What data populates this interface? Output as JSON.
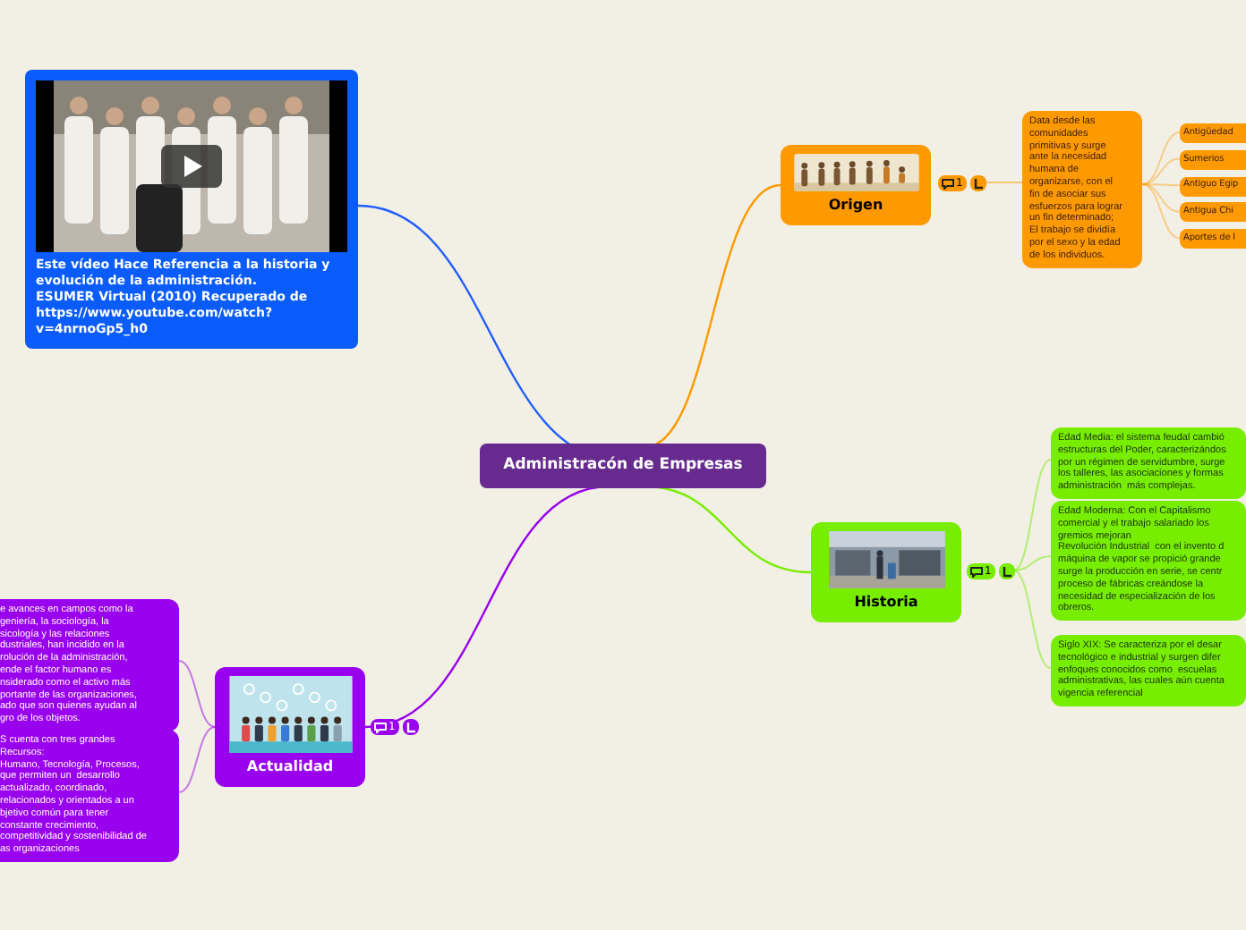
{
  "central": {
    "title": "Administracón de Empresas"
  },
  "video_card": {
    "lines": [
      "Este vídeo Hace Referencia a la historia y",
      "evolución de la administración.",
      "ESUMER Virtual (2010) Recuperado de",
      "https://www.youtube.com/watch?",
      "v=4nrnoGp5_h0"
    ]
  },
  "topics": [
    {
      "title": "Origen",
      "color": "#ff9900",
      "comment_count": "1",
      "notes": [
        {
          "lines": [
            "Data desde las",
            "comunidades",
            "primitivas y surge",
            "ante la necesidad",
            "humana de",
            "organizarse, con el",
            "fin de asociar sus",
            "esfuerzos para lograr",
            "un fin determinado;",
            "El trabajo se dividía",
            "por el sexo y la edad",
            "de los individuos."
          ]
        }
      ],
      "subtopics": [
        "Antigüedad",
        "Sumerios",
        "Antiguo Egip",
        "Antigua Chi",
        "Aportes de l"
      ]
    },
    {
      "title": "Historia",
      "color": "#77ee00",
      "comment_count": "1",
      "notes": [
        {
          "lines": [
            "Edad Media: el sistema feudal cambió",
            "estructuras del Poder, caracterizándos",
            "por un régimen de servidumbre, surge",
            "los talleres, las asociaciones y formas",
            "administración  más complejas."
          ]
        },
        {
          "lines": [
            "Edad Moderna: Con el Capitalismo",
            "comercial y el trabajo salariado los",
            "gremios mejoran",
            "Revolución Industrial  con el invento d",
            "máquina de vapor se propició grande",
            "surge la producción en serie, se centr",
            "proceso de fábricas creándose la",
            "necesidad de especialización de los",
            "obreros."
          ]
        },
        {
          "lines": [
            "Siglo XIX: Se caracteriza por el desar",
            "tecnológico e industrial y surgen difer",
            "enfoques conocidos como  escuelas",
            "administrativas, las cuales aún cuenta",
            "vigencia referencial"
          ]
        }
      ]
    },
    {
      "title": "Actualidad",
      "color": "#9900ee",
      "comment_count": "1",
      "notes": [
        {
          "lines": [
            "e avances en campos como la",
            "geniería, la sociología, la",
            "sicología y las relaciones",
            "dustriales, han incidido en la",
            "rolución de la administración,",
            "ende el factor humano es",
            "nsiderado como el activo más",
            "portante de las organizaciones,",
            "ado que son quienes ayudan al",
            "gro de los objetos."
          ]
        },
        {
          "lines": [
            "S cuenta con tres grandes",
            "Recursos:",
            "Humano, Tecnología, Procesos,",
            "que permiten un  desarrollo",
            "actualizado, coordinado,",
            "relacionados y orientados a un",
            "bjetivo común para tener",
            "constante crecimiento,",
            "competitividad y sostenibilidad de",
            "as organizaciones"
          ]
        }
      ]
    }
  ]
}
